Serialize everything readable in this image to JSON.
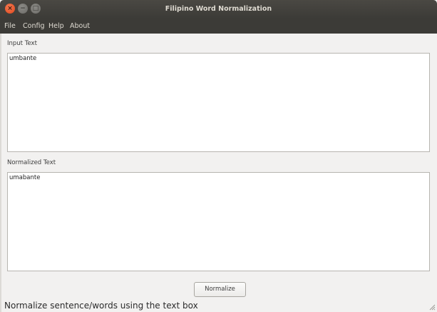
{
  "window": {
    "title": "Filipino Word Normalization",
    "controls": {
      "close_glyph": "×",
      "minimize_glyph": "−",
      "maximize_glyph": "□"
    }
  },
  "menu": [
    "File",
    "Config",
    "Help",
    "About"
  ],
  "input_section": {
    "label": "Input Text",
    "value": "umbante"
  },
  "output_section": {
    "label": "Normalized Text",
    "value": "umabante"
  },
  "normalize_button": {
    "label": "Normalize"
  },
  "status_bar": {
    "text": "Normalize sentence/words using the text box"
  },
  "colors": {
    "titlebar": "#3c3b37",
    "close_button": "#e95420",
    "background": "#f2f1f0"
  },
  "icons": {
    "resize_grip": "resize-grip-icon"
  }
}
